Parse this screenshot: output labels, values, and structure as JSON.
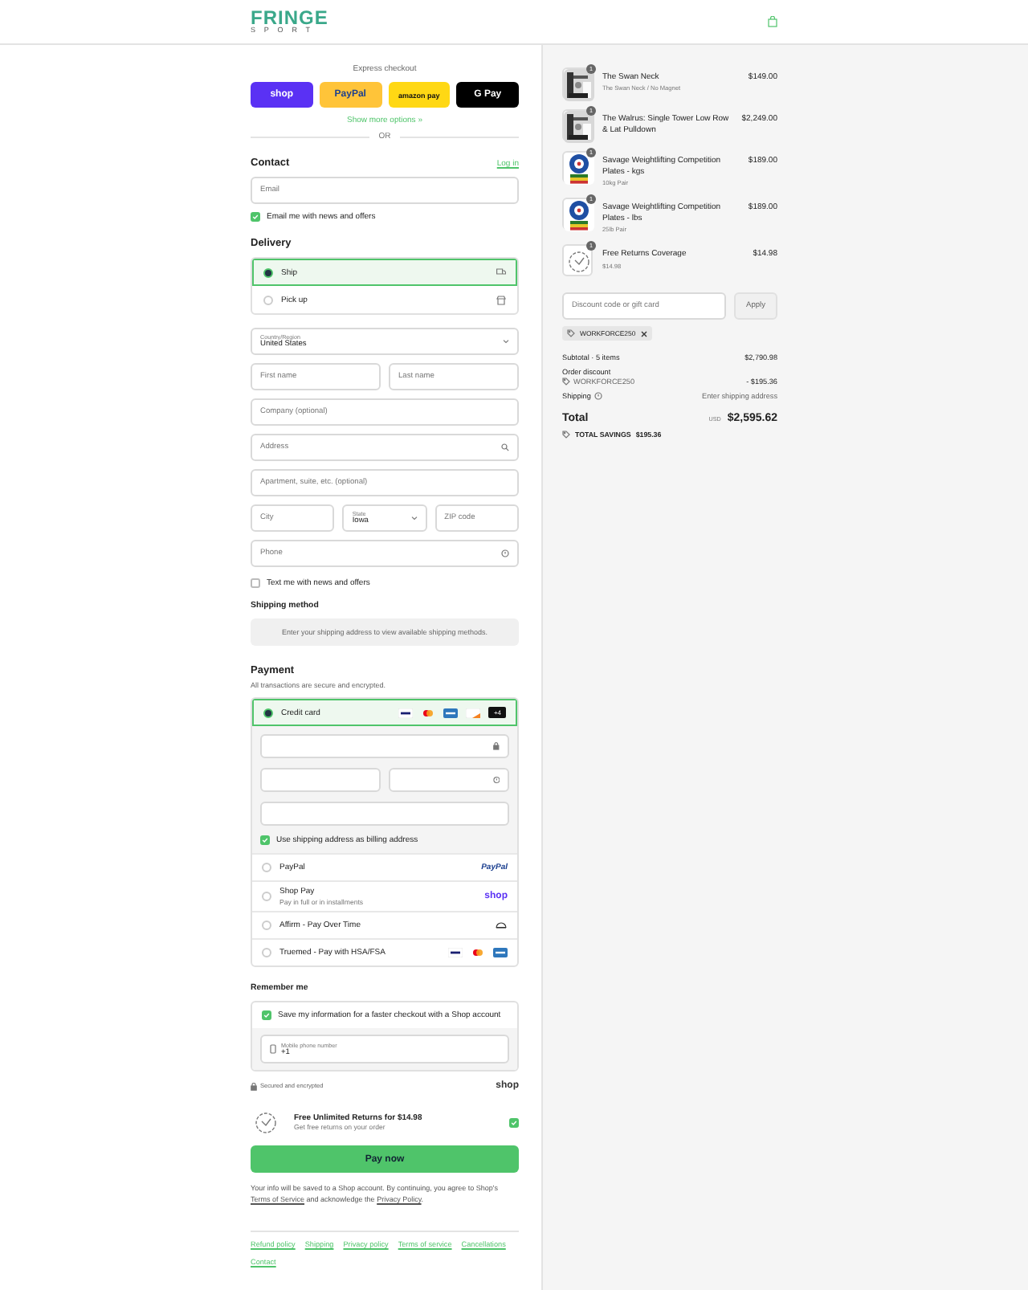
{
  "header": {
    "logo_main": "FRINGE",
    "logo_sub": "SPORT"
  },
  "express_checkout": {
    "title": "Express checkout",
    "buttons": [
      {
        "kind": "shop",
        "label": "shop"
      },
      {
        "kind": "paypal",
        "label": "PayPal"
      },
      {
        "kind": "amazon",
        "label": "amazon pay"
      },
      {
        "kind": "gpay",
        "label": "G Pay"
      }
    ],
    "more": "Show more options »",
    "divider": "OR"
  },
  "contact": {
    "title": "Contact",
    "login": "Log in",
    "email": {
      "placeholder": "Email"
    },
    "news": {
      "label": "Email me with news and offers",
      "checked": true
    }
  },
  "delivery": {
    "title": "Delivery",
    "options": [
      {
        "kind": "ship",
        "label": "Ship",
        "selected": true
      },
      {
        "kind": "pickup",
        "label": "Pick up",
        "selected": false
      }
    ],
    "rows": [
      [
        {
          "kind": "select",
          "label": "Country/Region",
          "value": "United States"
        }
      ],
      [
        {
          "kind": "text",
          "placeholder": "First name"
        },
        {
          "kind": "text",
          "placeholder": "Last name"
        }
      ],
      [
        {
          "kind": "text",
          "placeholder": "Company (optional)"
        }
      ],
      [
        {
          "kind": "search",
          "placeholder": "Address"
        }
      ],
      [
        {
          "kind": "text",
          "placeholder": "Apartment, suite, etc. (optional)"
        }
      ],
      [
        {
          "kind": "text",
          "placeholder": "City"
        },
        {
          "kind": "select",
          "label": "State",
          "value": "Iowa"
        },
        {
          "kind": "text",
          "placeholder": "ZIP code"
        }
      ],
      [
        {
          "kind": "help",
          "placeholder": "Phone"
        }
      ]
    ],
    "text_me": {
      "label": "Text me with news and offers",
      "checked": false
    }
  },
  "shipping_method": {
    "title": "Shipping method",
    "message": "Enter your shipping address to view available shipping methods."
  },
  "payment": {
    "title": "Payment",
    "subtitle": "All transactions are secure and encrypted.",
    "methods": [
      {
        "kind": "card",
        "label": "Credit card",
        "selected": true,
        "more": "+4"
      },
      {
        "kind": "paypal",
        "label": "PayPal",
        "selected": false,
        "logo": "PayPal"
      },
      {
        "kind": "shoppay",
        "label": "Shop Pay",
        "note": "Pay in full or in installments",
        "selected": false,
        "logo": "shop"
      },
      {
        "kind": "affirm",
        "label": "Affirm - Pay Over Time",
        "selected": false
      },
      {
        "kind": "truemed",
        "label": "Truemed - Pay with HSA/FSA",
        "selected": false
      }
    ],
    "billing": {
      "label": "Use shipping address as billing address",
      "checked": true
    }
  },
  "remember": {
    "title": "Remember me",
    "save": {
      "label": "Save my information for a faster checkout with a Shop account",
      "checked": true
    },
    "phone": {
      "label": "Mobile phone number",
      "value": "+1"
    },
    "secured": "Secured and encrypted",
    "logo": "shop"
  },
  "returns": {
    "title": "Free Unlimited Returns for $14.98",
    "subtitle": "Get free returns on your order",
    "checked": true
  },
  "pay_button": "Pay now",
  "disclaimer": {
    "before": "Your info will be saved to a Shop account. By continuing, you agree to Shop's",
    "terms": "Terms of Service",
    "middle": "and acknowledge the",
    "privacy": "Privacy Policy",
    "end": "."
  },
  "footer_links": [
    "Refund policy",
    "Shipping",
    "Privacy policy",
    "Terms of service",
    "Cancellations",
    "Contact"
  ],
  "summary": {
    "items": [
      {
        "name": "The Swan Neck",
        "variant": "The Swan Neck / No Magnet",
        "price": "$149.00",
        "quantity": "1"
      },
      {
        "name": "The Walrus: Single Tower Low Row & Lat Pulldown",
        "price": "$2,249.00",
        "quantity": "1"
      },
      {
        "kind": "plates",
        "name": "Savage Weightlifting Competition Plates - kgs",
        "variant": "10kg Pair",
        "price": "$189.00",
        "quantity": "1"
      },
      {
        "kind": "plates",
        "name": "Savage Weightlifting Competition Plates - lbs",
        "variant": "25lb Pair",
        "price": "$189.00",
        "quantity": "1"
      },
      {
        "kind": "coverage",
        "name": "Free Returns Coverage",
        "variant": "$14.98",
        "price": "$14.98",
        "quantity": "1"
      }
    ],
    "discount": {
      "placeholder": "Discount code or gift card",
      "apply": "Apply",
      "code": "WORKFORCE250"
    },
    "subtotal": {
      "label": "Subtotal · 5 items",
      "value": "$2,790.98"
    },
    "order_discount": {
      "label": "Order discount",
      "code": "WORKFORCE250",
      "value": "- $195.36"
    },
    "shipping": {
      "label": "Shipping",
      "value": "Enter shipping address"
    },
    "total": {
      "label": "Total",
      "currency": "USD",
      "value": "$2,595.62"
    },
    "savings": {
      "label": "TOTAL SAVINGS",
      "value": "$195.36"
    }
  }
}
